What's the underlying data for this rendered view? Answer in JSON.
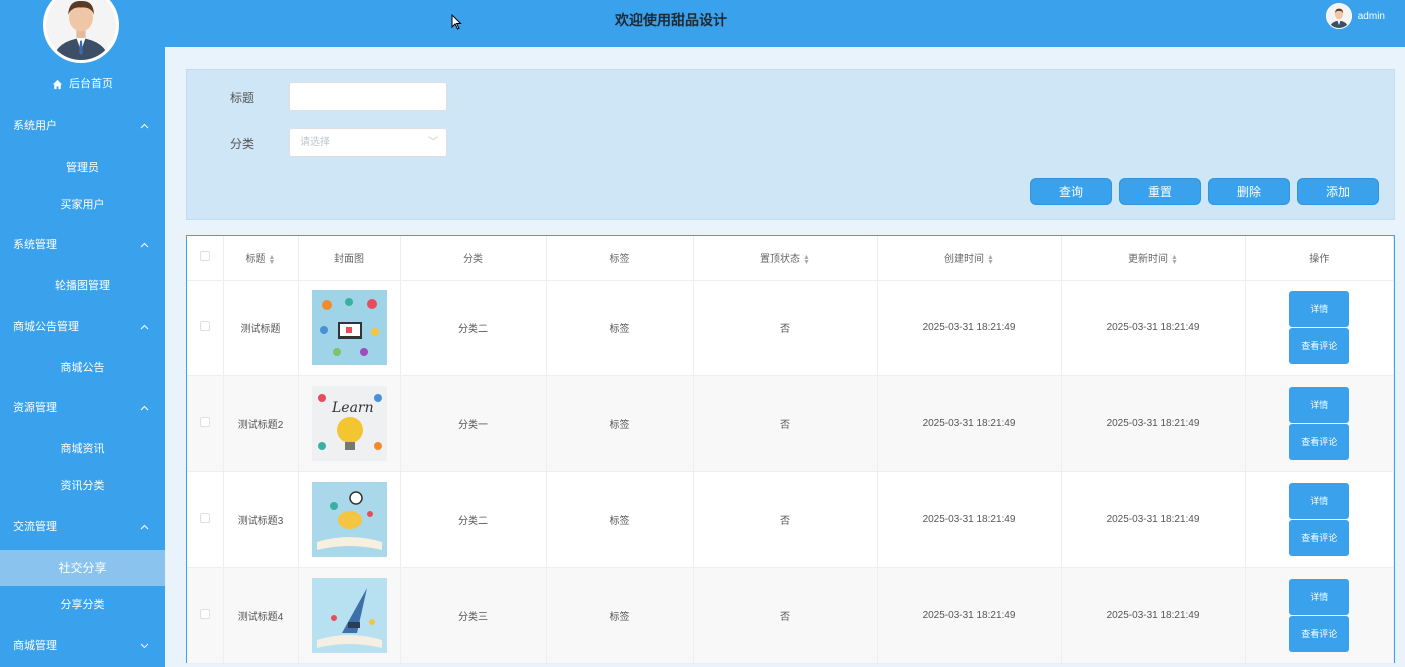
{
  "header": {
    "title": "欢迎使用甜品设计",
    "username": "admin"
  },
  "sidebar": {
    "home": "后台首页",
    "groups": [
      {
        "label": "系统用户",
        "items": [
          "管理员",
          "买家用户"
        ]
      },
      {
        "label": "系统管理",
        "items": [
          "轮播图管理"
        ]
      },
      {
        "label": "商城公告管理",
        "items": [
          "商城公告"
        ]
      },
      {
        "label": "资源管理",
        "items": [
          "商城资讯",
          "资讯分类"
        ]
      },
      {
        "label": "交流管理",
        "items": [
          "社交分享",
          "分享分类"
        ]
      },
      {
        "label": "商城管理",
        "items": []
      }
    ],
    "active_item": "社交分享"
  },
  "search": {
    "title_label": "标题",
    "title_value": "",
    "category_label": "分类",
    "category_placeholder": "请选择",
    "buttons": {
      "query": "查询",
      "reset": "重置",
      "delete": "删除",
      "add": "添加"
    }
  },
  "table": {
    "headers": [
      "标题",
      "封面图",
      "分类",
      "标签",
      "置顶状态",
      "创建时间",
      "更新时间",
      "操作"
    ],
    "rows": [
      {
        "title": "测试标题",
        "category": "分类二",
        "tag": "标签",
        "pinned": "否",
        "created": "2025-03-31 18:21:49",
        "updated": "2025-03-31 18:21:49"
      },
      {
        "title": "测试标题2",
        "category": "分类一",
        "tag": "标签",
        "pinned": "否",
        "created": "2025-03-31 18:21:49",
        "updated": "2025-03-31 18:21:49"
      },
      {
        "title": "测试标题3",
        "category": "分类二",
        "tag": "标签",
        "pinned": "否",
        "created": "2025-03-31 18:21:49",
        "updated": "2025-03-31 18:21:49"
      },
      {
        "title": "测试标题4",
        "category": "分类三",
        "tag": "标签",
        "pinned": "否",
        "created": "2025-03-31 18:21:49",
        "updated": "2025-03-31 18:21:49"
      }
    ],
    "actions": {
      "detail": "详情",
      "comments": "查看评论"
    }
  },
  "colors": {
    "primary": "#3aa1ec",
    "active_menu": "#8ac3ee"
  }
}
